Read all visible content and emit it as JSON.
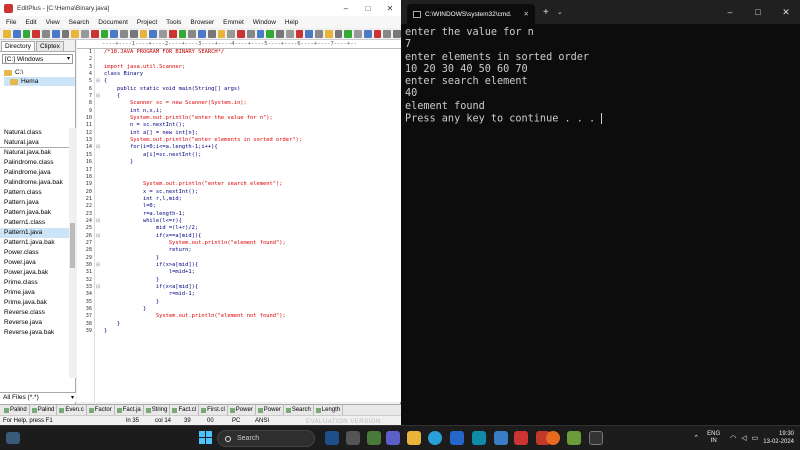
{
  "editplus": {
    "title": "EditPlus - [C:\\Hema\\Binary.java]",
    "menu": [
      "File",
      "Edit",
      "View",
      "Search",
      "Document",
      "Project",
      "Tools",
      "Browser",
      "Emmet",
      "Window",
      "Help"
    ],
    "dir_tabs": [
      "Directory",
      "Cliptex"
    ],
    "drive": "[C:] Windows",
    "tree": [
      "C:\\",
      "Hema"
    ],
    "files": [
      "Natural.class",
      "Natural.java",
      "Natural.java.bak",
      "Palindrome.class",
      "Palindrome.java",
      "Palindrome.java.bak",
      "Pattern.class",
      "Pattern.java",
      "Pattern.java.bak",
      "Pattern1.class",
      "Pattern1.java",
      "Pattern1.java.bak",
      "Power.class",
      "Power.java",
      "Power.java.bak",
      "Prime.class",
      "Prime.java",
      "Prime.java.bak",
      "Reverse.class",
      "Reverse.java",
      "Reverse.java.bak"
    ],
    "selected_file": "Pattern1.java",
    "filter": "All Files (*.*)",
    "ruler": "----+----1----+----2----+----3----+----4----+----5----+----6----+----7----+--",
    "code_lines": [
      "/*18.JAVA PROGRAM FOR BINARY SEARCH*/",
      "",
      "import java.util.Scanner;",
      "class Binary",
      "{",
      "    public static void main(String[] args)",
      "    {",
      "        Scanner sc = new Scanner(System.in);",
      "        int n,x,i;",
      "        System.out.println(\"enter the value for n\");",
      "        n = sc.nextInt();",
      "        int a[] = new int[n];",
      "        System.out.println(\"enter elements in sorted order\");",
      "        for(i=0;i<=a.length-1;i++){",
      "            a[i]=sc.nextInt();",
      "        }",
      "",
      "",
      "            System.out.println(\"enter search element\");",
      "            x = sc.nextInt();",
      "            int r,l,mid;",
      "            l=0;",
      "            r=a.length-1;",
      "            while(l<=r){",
      "                mid =(l+r)/2;",
      "                if(x==a[mid]){",
      "                    System.out.println(\"element found\");",
      "                    return;",
      "                }",
      "                if(x>a[mid]){",
      "                    l=mid+1;",
      "                }",
      "                if(x<a[mid]){",
      "                    r=mid-1;",
      "                }",
      "            }",
      "                System.out.println(\"element not found\");",
      "    }",
      "}"
    ],
    "line_count": 39,
    "file_tabs": [
      "Palind",
      "Palind",
      "Even.c",
      "Factor",
      "Fact.ja",
      "String",
      "Fact.cl",
      "First.cl",
      "Power",
      "Power",
      "Search",
      "Length"
    ],
    "status": {
      "help": "For Help, press F1",
      "ln": "ln 35",
      "col": "col 14",
      "n1": "39",
      "n2": "00",
      "pc": "PC",
      "enc": "ANSI",
      "watermark": "EVALUATION VERSION"
    }
  },
  "terminal": {
    "tab_title": "C:\\WINDOWS\\system32\\cmd.",
    "lines": [
      "enter the value for n",
      "7",
      "enter elements in sorted order",
      "10 20 30 40 50 60 70",
      "enter search element",
      "40",
      "element found",
      "Press any key to continue . . . "
    ]
  },
  "taskbar": {
    "search_placeholder": "Search",
    "lang": "ENG",
    "region": "IN",
    "time": "19:30",
    "date": "13-02-2024"
  }
}
